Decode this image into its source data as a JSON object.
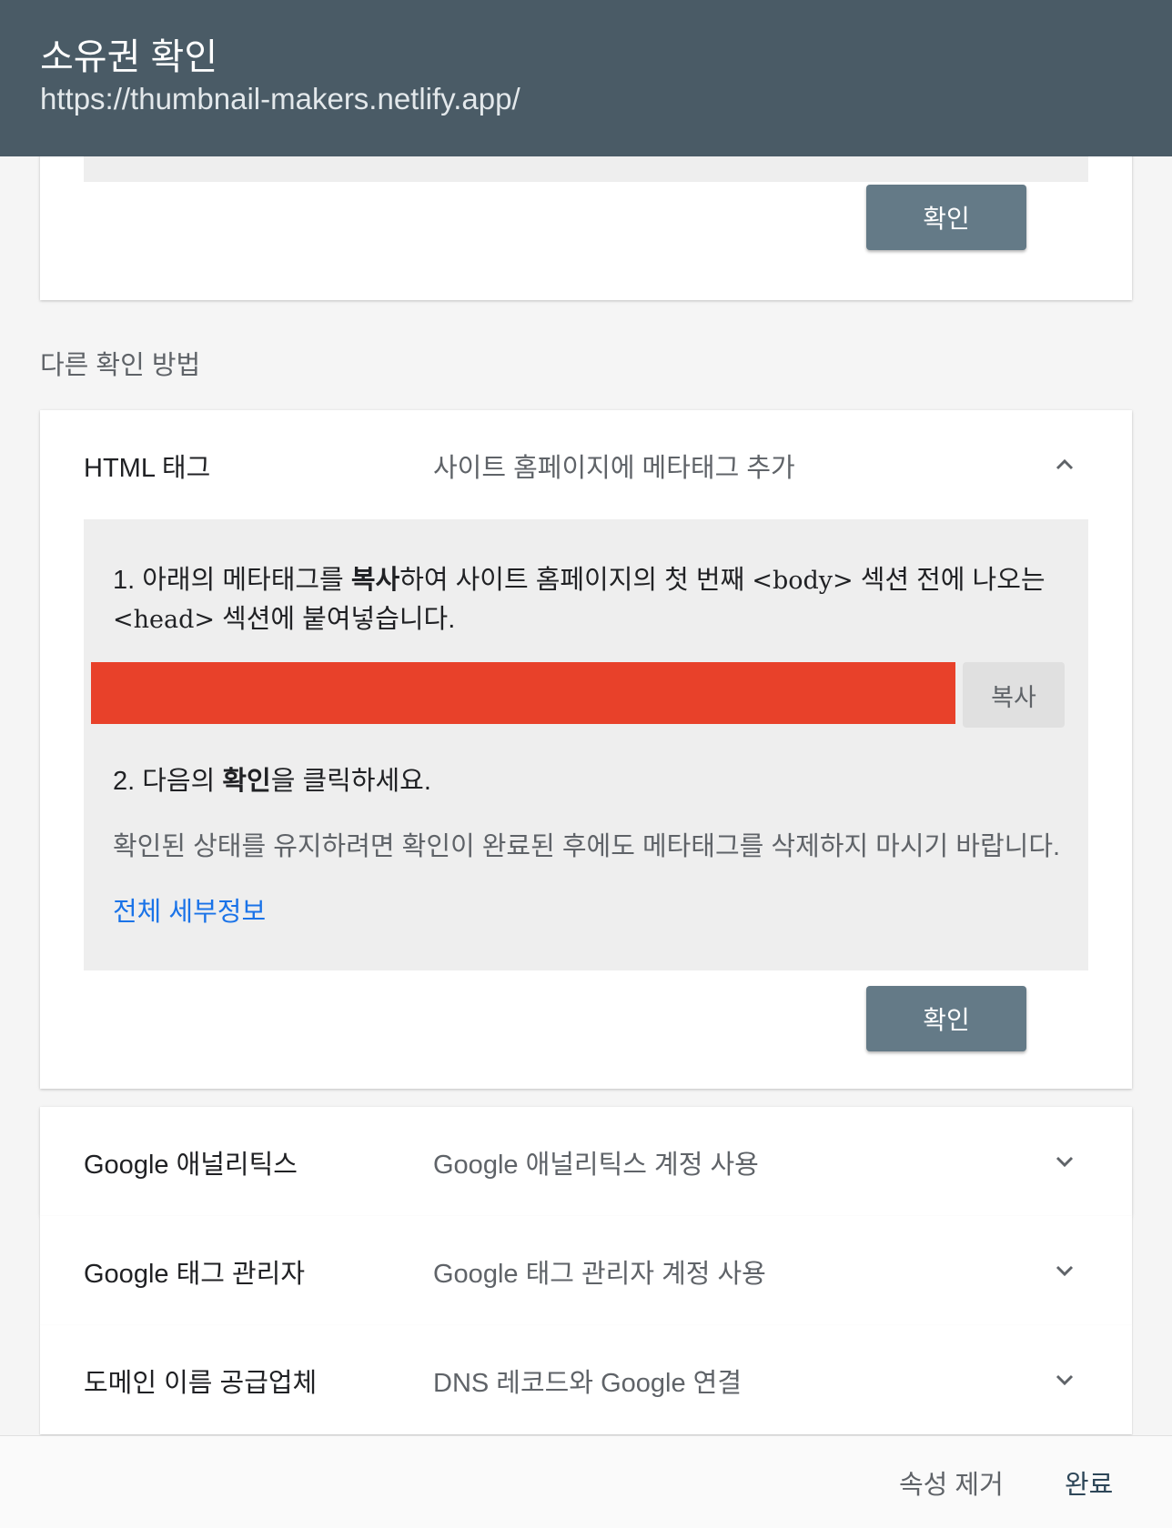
{
  "header": {
    "title": "소유권 확인",
    "url": "https://thumbnail-makers.netlify.app/"
  },
  "top_card": {
    "confirm_label": "확인"
  },
  "other_methods": {
    "label": "다른 확인 방법"
  },
  "html_tag": {
    "title": "HTML 태그",
    "description": "사이트 홈페이지에 메타태그 추가",
    "expand_icon": "chevron-up-icon",
    "step1": {
      "prefix": "1. 아래의 메타태그를 ",
      "bold": "복사",
      "middle": "하여 사이트 홈페이지의 첫 번째 ",
      "tag_body": "<body>",
      "after_body": " 섹션 전에 나오는",
      "tag_head": "<head>",
      "suffix": " 섹션에 붙여넣습니다."
    },
    "copy_label": "복사",
    "step2": {
      "prefix": "2. 다음의 ",
      "bold": "확인",
      "suffix": "을 클릭하세요."
    },
    "note": "확인된 상태를 유지하려면 확인이 완료된 후에도 메타태그를 삭제하지 마시기 바랍니다.",
    "details_link": "전체 세부정보",
    "confirm_label": "확인"
  },
  "methods": [
    {
      "title": "Google 애널리틱스",
      "description": "Google 애널리틱스 계정 사용",
      "icon": "chevron-down-icon"
    },
    {
      "title": "Google 태그 관리자",
      "description": "Google 태그 관리자 계정 사용",
      "icon": "chevron-down-icon"
    },
    {
      "title": "도메인 이름 공급업체",
      "description": "DNS 레코드와 Google 연결",
      "icon": "chevron-down-icon"
    }
  ],
  "footer": {
    "remove_label": "속성 제거",
    "done_label": "완료"
  },
  "colors": {
    "header_bg": "#4a5b66",
    "button_bg": "#647a87",
    "redacted": "#e8412a",
    "link": "#1a73e8"
  }
}
